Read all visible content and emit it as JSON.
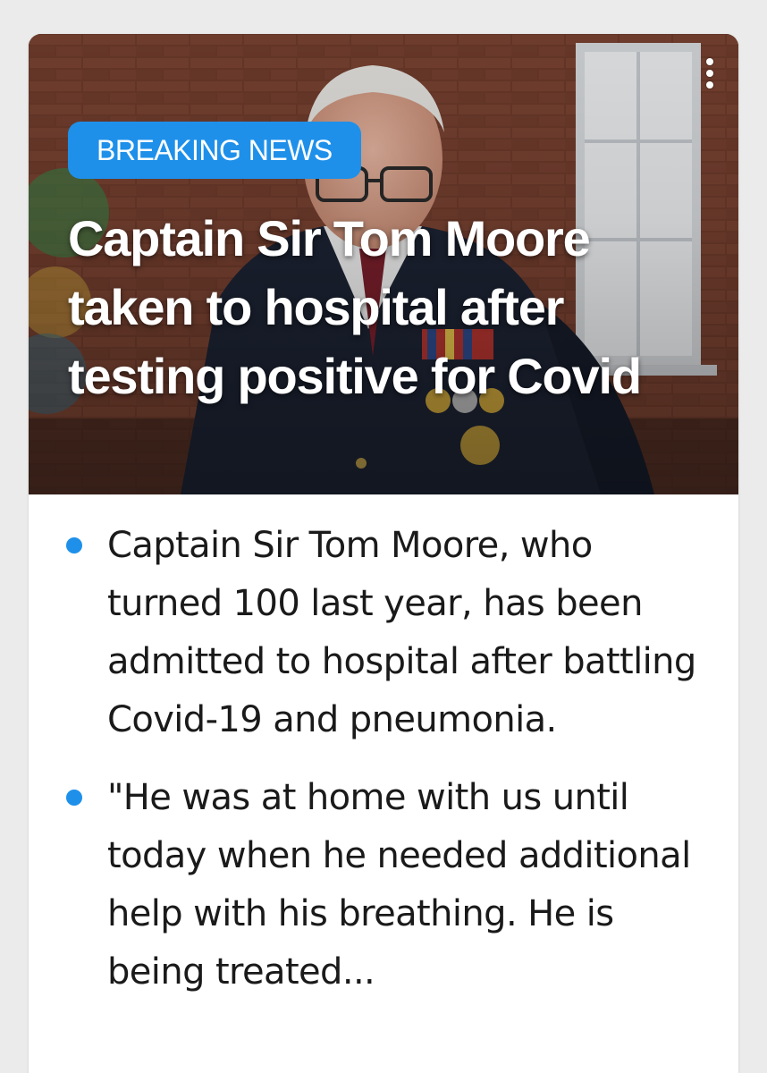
{
  "article": {
    "badge": "BREAKING NEWS",
    "headline": "Captain Sir Tom Moore taken to hospital after testing positive for Covid",
    "menu_icon": "more-vertical-icon",
    "accent_color": "#1e90ea",
    "bullets": [
      "Captain Sir Tom Moore, who turned 100 last year, has been admitted to hospital after battling Covid-19 and pneumonia.",
      "\"He was at home with us until today when he needed additional help with his breathing. He is being treated..."
    ]
  }
}
